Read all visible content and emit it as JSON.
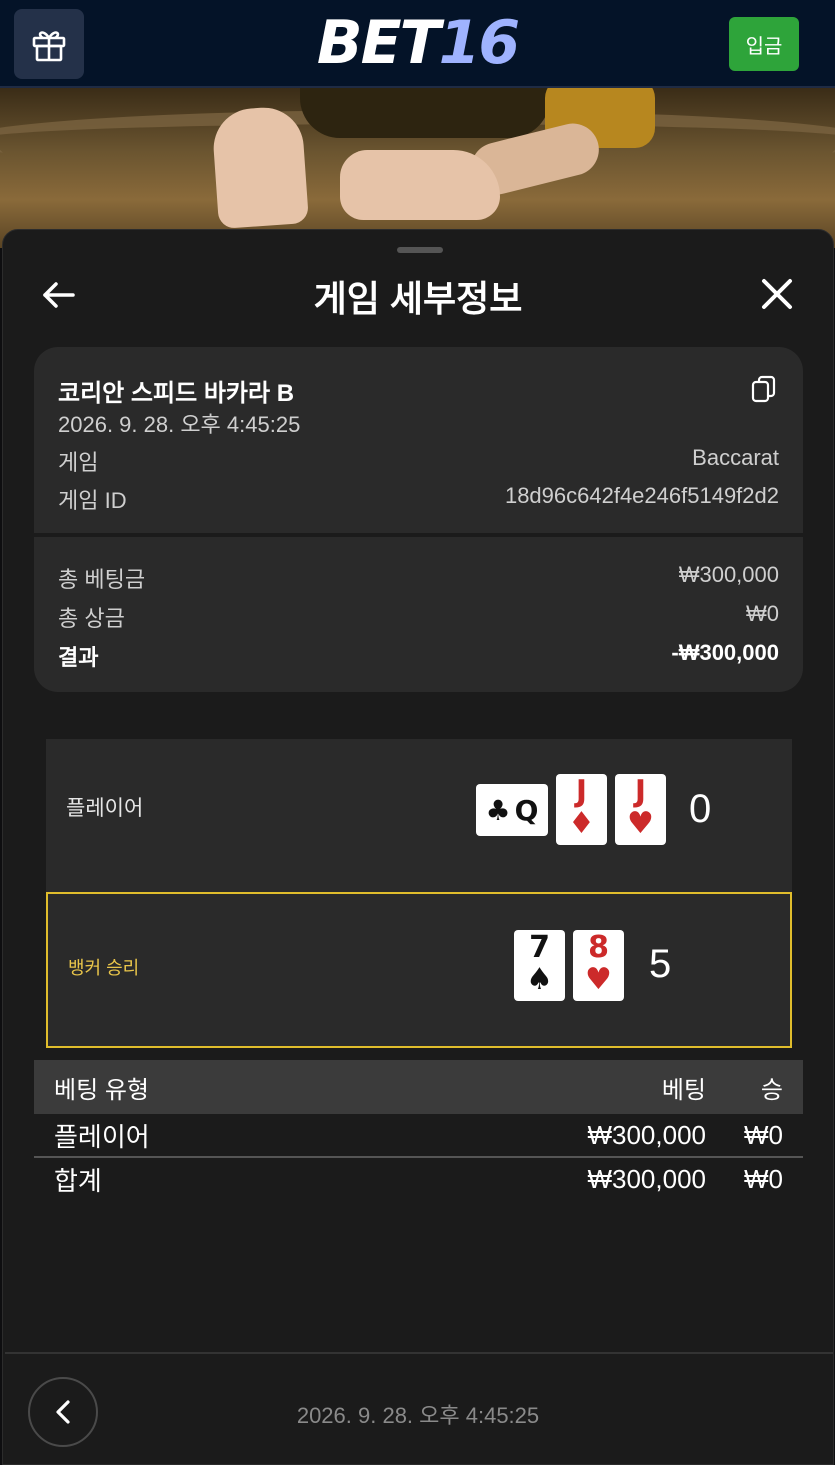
{
  "header": {
    "logo_main": "BET",
    "logo_num": "16",
    "deposit_label": "입금"
  },
  "sheet": {
    "title": "게임 세부정보"
  },
  "game": {
    "name": "코리안 스피드 바카라 B",
    "datetime": "2026. 9. 28. 오후 4:45:25",
    "game_label": "게임",
    "game_value": "Baccarat",
    "id_label": "게임 ID",
    "id_value": "18d96c642f4e246f5149f2d2",
    "total_bet_label": "총 베팅금",
    "total_bet_value": "₩300,000",
    "total_win_label": "총 상금",
    "total_win_value": "₩0",
    "result_label": "결과",
    "result_value": "-₩300,000"
  },
  "rounds": {
    "player": {
      "label": "플레이어",
      "score": "0",
      "cards": [
        {
          "rank": "Q",
          "suit": "♣",
          "color": "black",
          "sideways": true
        },
        {
          "rank": "J",
          "suit": "♦",
          "color": "red"
        },
        {
          "rank": "J",
          "suit": "♥",
          "color": "red"
        }
      ]
    },
    "banker": {
      "label": "뱅커 승리",
      "score": "5",
      "cards": [
        {
          "rank": "7",
          "suit": "♠",
          "color": "black"
        },
        {
          "rank": "8",
          "suit": "♥",
          "color": "red"
        }
      ]
    }
  },
  "bets": {
    "headers": {
      "type": "베팅 유형",
      "bet": "베팅",
      "win": "승"
    },
    "rows": [
      {
        "type": "플레이어",
        "bet": "₩300,000",
        "win": "₩0"
      }
    ],
    "total": {
      "type": "합계",
      "bet": "₩300,000",
      "win": "₩0"
    }
  },
  "footer": {
    "datetime": "2026. 9. 28. 오후 4:45:25"
  },
  "colors": {
    "accent_green": "#2ea43a",
    "winner_border": "#e0bd2c",
    "header_bg": "#041328"
  }
}
